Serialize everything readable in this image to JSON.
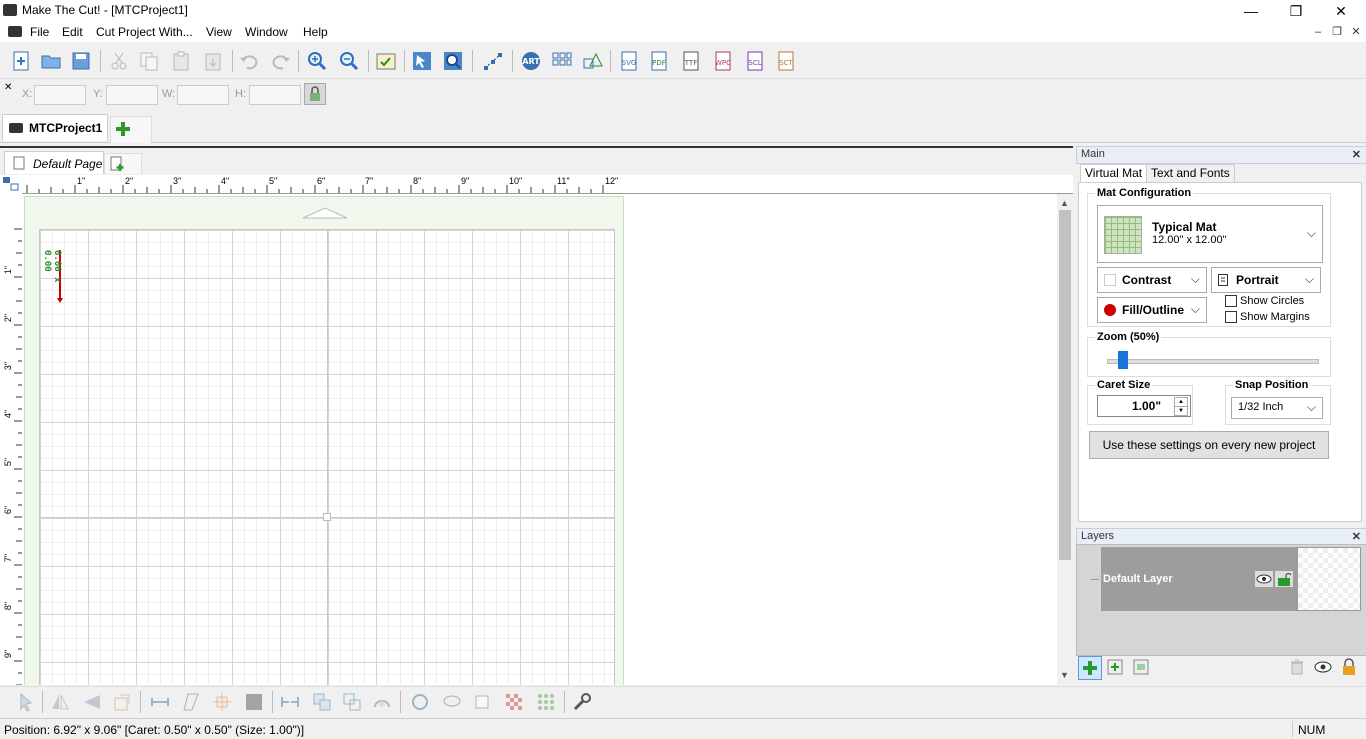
{
  "window": {
    "title": "Make The Cut! - [MTCProject1]",
    "minimize": "—",
    "maximize": "❐",
    "close": "✕"
  },
  "menu": [
    {
      "label": "File"
    },
    {
      "label": "Edit"
    },
    {
      "label": "Cut Project With..."
    },
    {
      "label": "View"
    },
    {
      "label": "Window"
    },
    {
      "label": "Help"
    }
  ],
  "position_bar": {
    "x_label": "X:",
    "y_label": "Y:",
    "w_label": "W:",
    "h_label": "H:"
  },
  "project_tab": {
    "label": "MTCProject1"
  },
  "page_tab": {
    "label": "Default Page"
  },
  "ruler_h_labels": [
    "1\"",
    "2\"",
    "3\"",
    "4\"",
    "5\"",
    "6\"",
    "7\"",
    "8\"",
    "9\"",
    "10\"",
    "11\"",
    "12\""
  ],
  "ruler_v_labels": [
    "1\"",
    "2\"",
    "3\"",
    "4\"",
    "5\"",
    "6\"",
    "7\"",
    "8\"",
    "9\""
  ],
  "caret_label": "0.00 x 0.00",
  "side_panel": {
    "main_title": "Main",
    "tabs": [
      "Virtual Mat",
      "Text and Fonts"
    ],
    "mat_config_title": "Mat Configuration",
    "mat_name": "Typical Mat",
    "mat_size": "12.00\" x 12.00\"",
    "contrast_label": "Contrast",
    "orientation_label": "Portrait",
    "fill_label": "Fill/Outline",
    "show_circles": "Show Circles",
    "show_margins": "Show Margins",
    "zoom_title": "Zoom (50%)",
    "zoom_value": 0.05,
    "caret_title": "Caret Size",
    "caret_value": "1.00\"",
    "snap_title": "Snap Position",
    "snap_value": "1/32 Inch",
    "apply_button": "Use these settings on every new project"
  },
  "layers": {
    "title": "Layers",
    "items": [
      {
        "name": "Default Layer"
      }
    ]
  },
  "status": {
    "position": "Position: 6.92\" x 9.06\" [Caret: 0.50\" x 0.50\" (Size: 1.00\")]",
    "num": "NUM"
  },
  "colors": {
    "accent_blue": "#1a73d9",
    "mat_green": "#f0f7ec",
    "caret_red": "#cc0000",
    "caret_green": "#2a8a2a"
  }
}
